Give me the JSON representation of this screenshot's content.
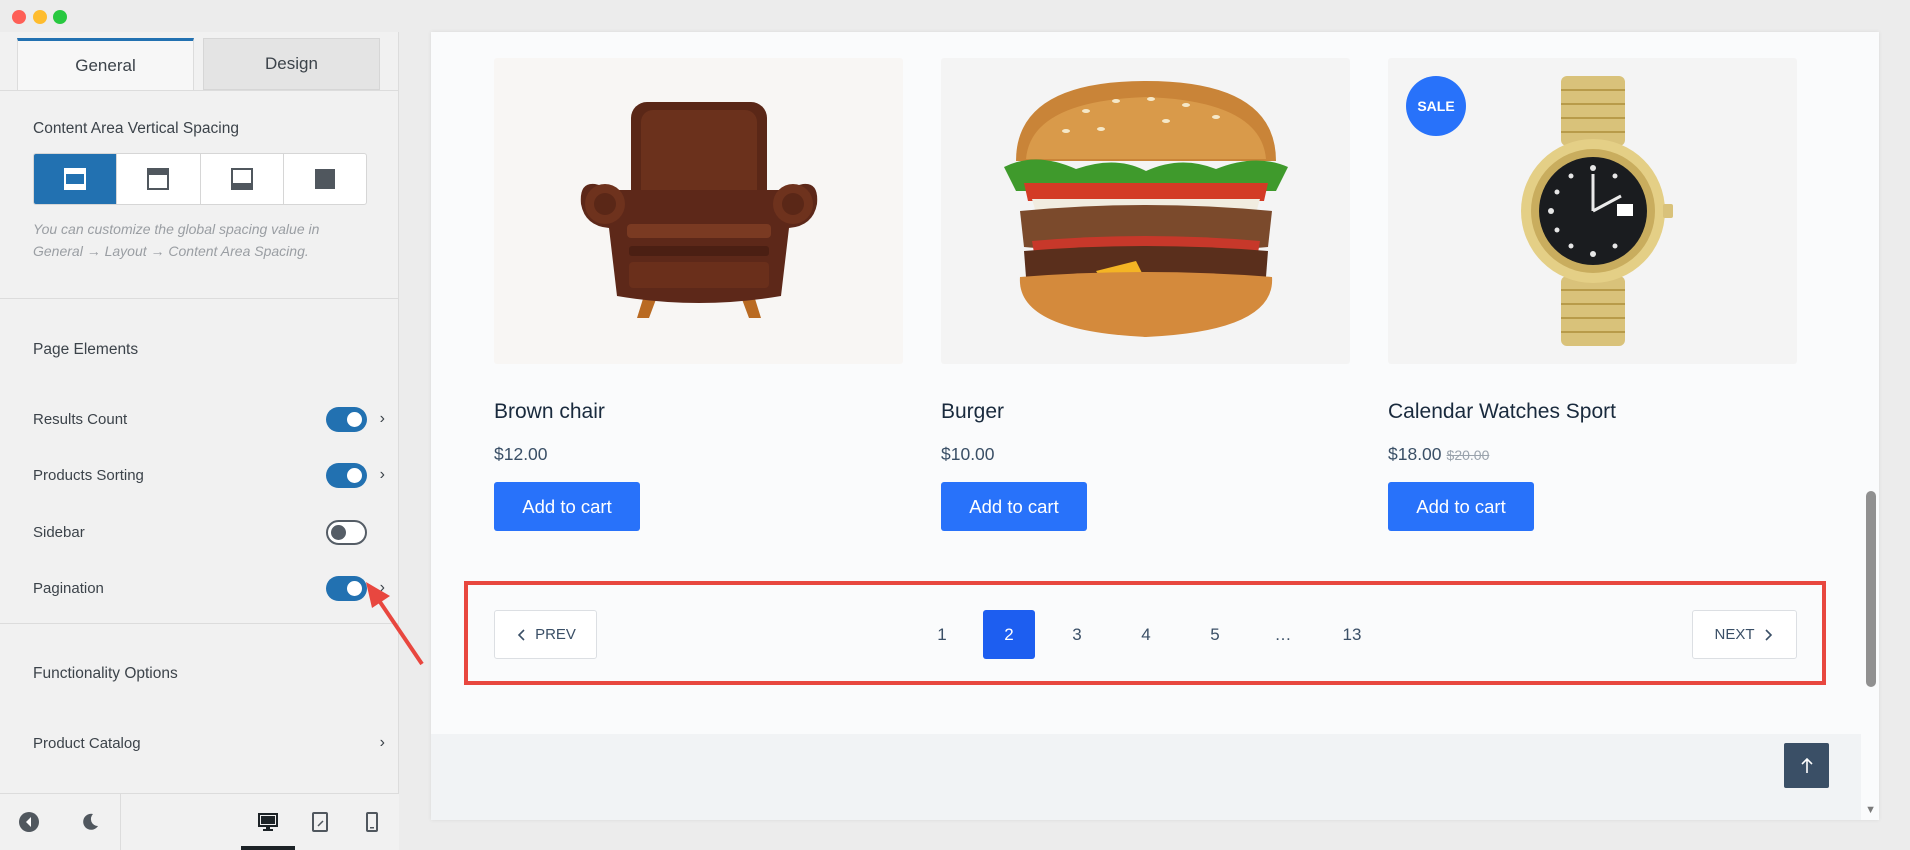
{
  "tabs": {
    "general": "General",
    "design": "Design"
  },
  "content_spacing": {
    "label": "Content Area Vertical Spacing",
    "help": "You can customize the global spacing value in General → Layout → Content Area Spacing.",
    "selected": "top-and-bottom"
  },
  "page_elements": {
    "heading": "Page Elements",
    "items": [
      {
        "label": "Results Count",
        "enabled": true
      },
      {
        "label": "Products Sorting",
        "enabled": true
      },
      {
        "label": "Sidebar",
        "enabled": false
      },
      {
        "label": "Pagination",
        "enabled": true
      }
    ]
  },
  "functionality": {
    "heading": "Functionality Options",
    "product_catalog": "Product Catalog"
  },
  "bottom_bar": {
    "icons": [
      "back-icon",
      "dark-mode-icon",
      "desktop-icon",
      "tablet-icon",
      "mobile-icon"
    ],
    "active_device": "desktop"
  },
  "products": [
    {
      "title": "Brown chair",
      "price": "$12.00",
      "old_price": "",
      "sale": "",
      "cart": "Add to cart"
    },
    {
      "title": "Burger",
      "price": "$10.00",
      "old_price": "",
      "sale": "",
      "cart": "Add to cart"
    },
    {
      "title": "Calendar Watches Sport",
      "price": "$18.00",
      "old_price": "$20.00",
      "sale": "SALE",
      "cart": "Add to cart"
    }
  ],
  "pagination": {
    "prev": "PREV",
    "next": "NEXT",
    "pages": [
      "1",
      "2",
      "3",
      "4",
      "5",
      "…",
      "13"
    ],
    "current": "2"
  },
  "colors": {
    "accent": "#2271b1",
    "button": "#2872fa",
    "current_page": "#1d5ef0",
    "highlight": "#e8473f"
  }
}
